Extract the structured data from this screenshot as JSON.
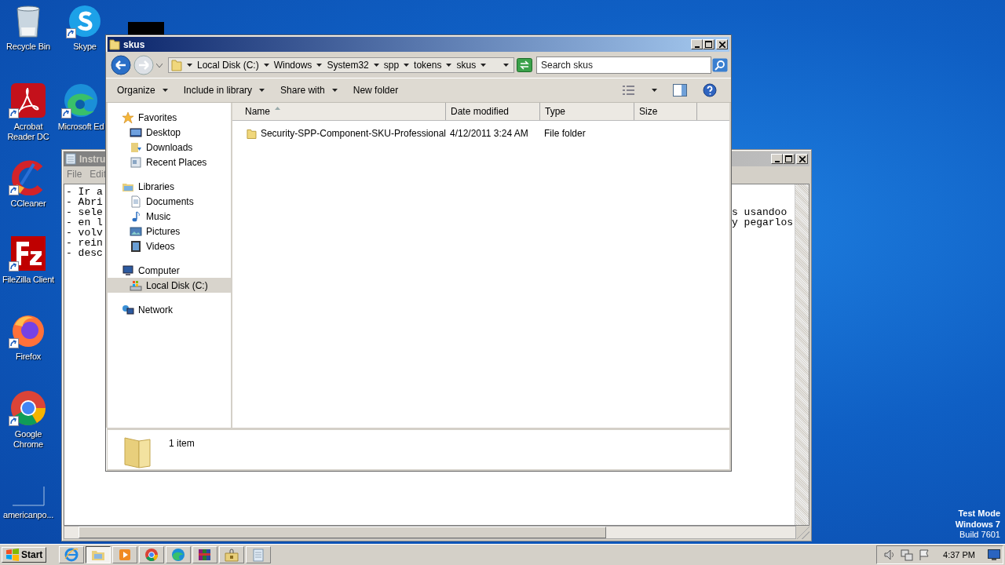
{
  "desktop_icons": [
    {
      "label": "Recycle Bin",
      "kind": "recycle",
      "shortcut": false
    },
    {
      "label": "Skype",
      "kind": "skype",
      "shortcut": true
    },
    {
      "label": "Acrobat Reader DC",
      "kind": "acrobat",
      "shortcut": true
    },
    {
      "label": "Microsoft Ed",
      "kind": "edge",
      "shortcut": true
    },
    {
      "label": "CCleaner",
      "kind": "ccleaner",
      "shortcut": true
    },
    {
      "label": "FileZilla Client",
      "kind": "filezilla",
      "shortcut": true
    },
    {
      "label": "Firefox",
      "kind": "firefox",
      "shortcut": true
    },
    {
      "label": "Google Chrome",
      "kind": "chrome",
      "shortcut": true
    },
    {
      "label": "americanpo...",
      "kind": "blank",
      "shortcut": false
    }
  ],
  "notepad": {
    "title": "Instru",
    "menu": [
      "File",
      "Edit"
    ],
    "left_text": [
      "- Ir a",
      "- Abri",
      "- sele",
      "- en l",
      "- volv",
      "- rein",
      "- desc"
    ],
    "right_text": [
      "s usandoo",
      "y pegarlos"
    ]
  },
  "explorer": {
    "title": "skus",
    "breadcrumbs": [
      "Local Disk (C:)",
      "Windows",
      "System32",
      "spp",
      "tokens",
      "skus"
    ],
    "search": {
      "placeholder": "Search skus"
    },
    "toolbar": [
      {
        "label": "Organize",
        "dropdown": true
      },
      {
        "label": "Include in library",
        "dropdown": true
      },
      {
        "label": "Share with",
        "dropdown": true
      },
      {
        "label": "New folder",
        "dropdown": false
      }
    ],
    "nav": [
      {
        "label": "Favorites",
        "kind": "star",
        "selected": false,
        "children": [
          {
            "label": "Desktop",
            "kind": "desktop",
            "selected": false
          },
          {
            "label": "Downloads",
            "kind": "downloads",
            "selected": false
          },
          {
            "label": "Recent Places",
            "kind": "recent",
            "selected": false
          }
        ]
      },
      {
        "label": "Libraries",
        "kind": "library",
        "selected": false,
        "children": [
          {
            "label": "Documents",
            "kind": "documents",
            "selected": false
          },
          {
            "label": "Music",
            "kind": "music",
            "selected": false
          },
          {
            "label": "Pictures",
            "kind": "pictures",
            "selected": false
          },
          {
            "label": "Videos",
            "kind": "videos",
            "selected": false
          }
        ]
      },
      {
        "label": "Computer",
        "kind": "computer",
        "selected": false,
        "children": [
          {
            "label": "Local Disk (C:)",
            "kind": "disk",
            "selected": true
          }
        ]
      },
      {
        "label": "Network",
        "kind": "network",
        "selected": false
      }
    ],
    "columns": [
      {
        "label": "Name",
        "sorted": true
      },
      {
        "label": "Date modified",
        "sorted": false
      },
      {
        "label": "Type",
        "sorted": false
      },
      {
        "label": "Size",
        "sorted": false
      }
    ],
    "rows": [
      {
        "name": "Security-SPP-Component-SKU-Professional",
        "date_modified": "4/12/2011 3:24 AM",
        "type": "File folder"
      }
    ],
    "status": "1 item"
  },
  "system_notice": [
    "Test Mode",
    "Windows 7",
    "Build 7601"
  ],
  "taskbar": {
    "start": "Start",
    "apps": [
      {
        "kind": "ie",
        "selected": false
      },
      {
        "kind": "explorer",
        "selected": true
      },
      {
        "kind": "media",
        "selected": false
      },
      {
        "kind": "chrome",
        "selected": false
      },
      {
        "kind": "edge",
        "selected": false
      },
      {
        "kind": "winrar",
        "selected": false
      },
      {
        "kind": "lockfolder",
        "selected": false
      },
      {
        "kind": "notepad",
        "selected": false
      }
    ],
    "clock": "4:37 PM"
  }
}
